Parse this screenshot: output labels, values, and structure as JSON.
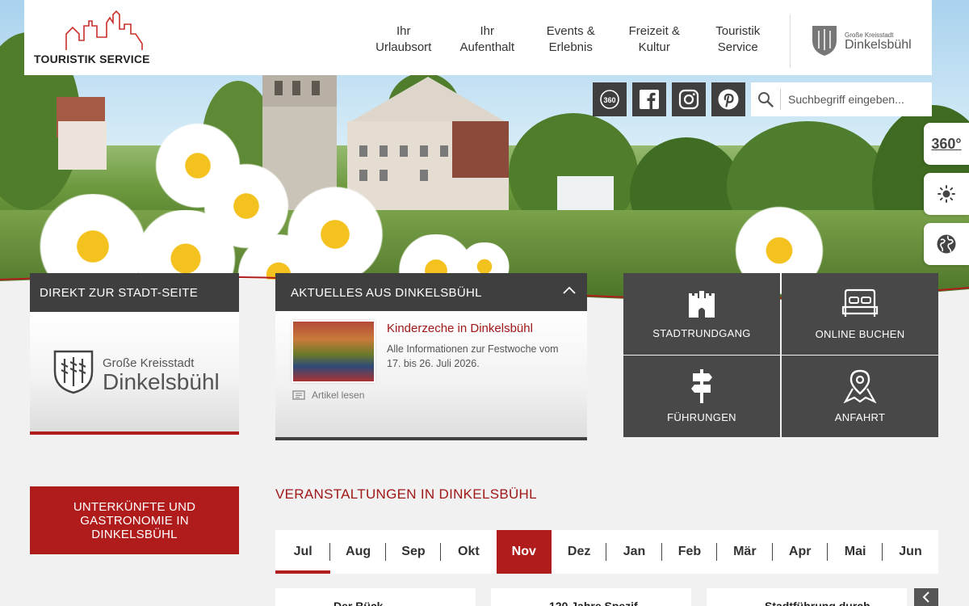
{
  "header": {
    "brand": "TOURISTIK SERVICE",
    "nav": [
      {
        "line1": "Ihr",
        "line2": "Urlaubsort"
      },
      {
        "line1": "Ihr",
        "line2": "Aufenthalt"
      },
      {
        "line1": "Events &",
        "line2": "Erlebnis"
      },
      {
        "line1": "Freizeit &",
        "line2": "Kultur"
      },
      {
        "line1": "Touristik",
        "line2": "Service"
      }
    ],
    "city_logo": {
      "small": "Große Kreisstadt",
      "large": "Dinkelsbühl"
    }
  },
  "social": [
    "360-icon",
    "facebook-icon",
    "instagram-icon",
    "pinterest-icon"
  ],
  "search": {
    "placeholder": "Suchbegriff eingeben..."
  },
  "side_tabs": {
    "tour": "360°"
  },
  "city_panel": {
    "header": "DIREKT ZUR STADT-SEITE",
    "small": "Große Kreisstadt",
    "large": "Dinkelsbühl"
  },
  "news": {
    "header": "AKTUELLES AUS DINKELSBÜHL",
    "title": "Kinderzeche in Dinkelsbühl",
    "text": "Alle Informationen zur Festwoche vom 17. bis 26. Juli 2026.",
    "more": "Artikel lesen"
  },
  "tiles": [
    {
      "label": "STADTRUNDGANG",
      "icon": "castle-icon"
    },
    {
      "label": "ONLINE BUCHEN",
      "icon": "bed-icon"
    },
    {
      "label": "FÜHRUNGEN",
      "icon": "signpost-icon"
    },
    {
      "label": "ANFAHRT",
      "icon": "map-pin-icon"
    }
  ],
  "accommodation": {
    "line1": "UNTERKÜNFTE UND",
    "line2": "GASTRONOMIE IN",
    "line3": "DINKELSBÜHL"
  },
  "events": {
    "title": "VERANSTALTUNGEN IN DINKELSBÜHL",
    "months": [
      "Jul",
      "Aug",
      "Sep",
      "Okt",
      "Nov",
      "Dez",
      "Jan",
      "Feb",
      "Mär",
      "Apr",
      "Mai",
      "Jun"
    ],
    "active_month": "Nov",
    "cards": [
      "Der Bück",
      "120 Jahre Spezif",
      "Stadtführung durch"
    ]
  },
  "colors": {
    "accent": "#b01c1c",
    "dark": "#3f3f3f",
    "tile": "#484848"
  }
}
